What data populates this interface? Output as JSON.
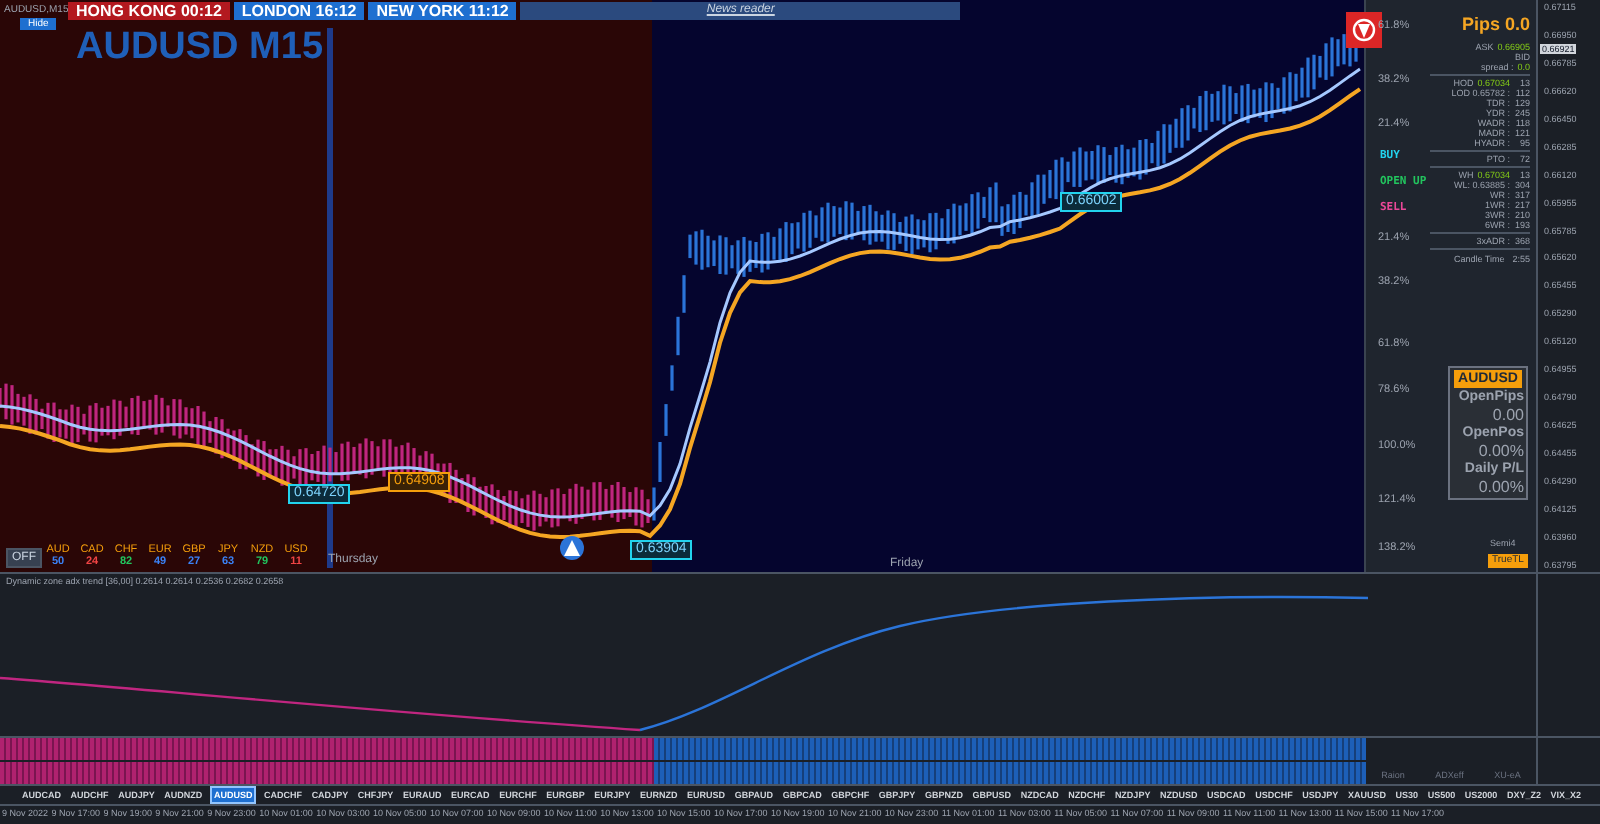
{
  "chart_header": {
    "caption": "AUDUSD,M15",
    "hide_button": "Hide"
  },
  "sessions": [
    {
      "label": "HONG KONG",
      "time": "00:12",
      "color": "#b3191f"
    },
    {
      "label": "LONDON",
      "time": "16:12",
      "color": "#1e6fd0"
    },
    {
      "label": "NEW YORK",
      "time": "11:12",
      "color": "#1e6fd0"
    }
  ],
  "news_reader": "News reader",
  "symbol_title": "AUDUSD M15",
  "fib_levels": [
    "61.8%",
    "38.2%",
    "21.4%",
    "21.4%",
    "38.2%",
    "61.8%",
    "78.6%",
    "100.0%",
    "121.4%",
    "138.2%"
  ],
  "signals": [
    {
      "label": "BUY",
      "color": "#22d3ee"
    },
    {
      "label": "OPEN UP",
      "color": "#22c55e"
    },
    {
      "label": "SELL",
      "color": "#ec4899"
    }
  ],
  "price_tags": [
    {
      "label": "0.64720",
      "kind": "cyan"
    },
    {
      "label": "0.64908",
      "kind": "orange"
    },
    {
      "label": "0.63904",
      "kind": "cyan"
    },
    {
      "label": "0.66002",
      "kind": "cyan"
    }
  ],
  "day_labels": [
    "Thursday",
    "Friday"
  ],
  "strength": {
    "toggle": "OFF",
    "currencies": [
      {
        "code": "AUD",
        "value": "50",
        "color": "#3b82f6"
      },
      {
        "code": "CAD",
        "value": "24",
        "color": "#ef4444"
      },
      {
        "code": "CHF",
        "value": "82",
        "color": "#22c55e"
      },
      {
        "code": "EUR",
        "value": "49",
        "color": "#3b82f6"
      },
      {
        "code": "GBP",
        "value": "27",
        "color": "#3b82f6"
      },
      {
        "code": "JPY",
        "value": "63",
        "color": "#3b82f6"
      },
      {
        "code": "NZD",
        "value": "79",
        "color": "#22c55e"
      },
      {
        "code": "USD",
        "value": "11",
        "color": "#ef4444"
      }
    ]
  },
  "info_panel": {
    "pips": "Pips 0.0",
    "groups": [
      [
        {
          "label": "ASK",
          "value": "0.66905"
        },
        {
          "label": "BID"
        },
        {
          "label": "spread :",
          "value": "0.0"
        }
      ],
      [
        {
          "label": "HOD",
          "value": "0.67034",
          "count": "13"
        },
        {
          "label": "LOD 0.65782 :",
          "count": "112"
        },
        {
          "label": "TDR :",
          "count": "129"
        },
        {
          "label": "YDR :",
          "count": "245"
        },
        {
          "label": "WADR :",
          "count": "118"
        },
        {
          "label": "MADR :",
          "count": "121"
        },
        {
          "label": "HYADR :",
          "count": "95"
        }
      ],
      [
        {
          "label": "PTO :",
          "count": "72"
        }
      ],
      [
        {
          "label": "WH",
          "value": "0.67034",
          "count": "13"
        },
        {
          "label": "WL: 0.63885 :",
          "count": "304"
        },
        {
          "label": "WR :",
          "count": "317"
        },
        {
          "label": "1WR :",
          "count": "217"
        },
        {
          "label": "3WR :",
          "count": "210"
        },
        {
          "label": "6WR :",
          "count": "193"
        }
      ],
      [
        {
          "label": "3xADR :",
          "count": "368"
        }
      ]
    ],
    "candle_time_label": "Candle Time",
    "candle_time": "2:55"
  },
  "account_box": {
    "symbol": "AUDUSD",
    "rows": [
      {
        "label": "OpenPips",
        "value": "0.00"
      },
      {
        "label": "OpenPos",
        "value": "0.00%"
      },
      {
        "label": "Daily P/L",
        "value": "0.00%"
      }
    ]
  },
  "semi_label": "Semi4",
  "truetl_button": "TrueTL",
  "current_price": "0.66921",
  "price_axis": [
    "0.67115",
    "0.66950",
    "0.66785",
    "0.66620",
    "0.66450",
    "0.66285",
    "0.66120",
    "0.65955",
    "0.65785",
    "0.65620",
    "0.65455",
    "0.65290",
    "0.65120",
    "0.64955",
    "0.64790",
    "0.64625",
    "0.64455",
    "0.64290",
    "0.64125",
    "0.63960",
    "0.63795"
  ],
  "indicator": {
    "label": "Dynamic zone adx trend [36,00] 0.2614 0.2614 0.2536 0.2682 0.2658"
  },
  "histogram_labels": [
    "Raion",
    "ADXeff",
    "XU-eA"
  ],
  "symbols": [
    {
      "label": "AUDCAD",
      "selected": false
    },
    {
      "label": "AUDCHF",
      "selected": false
    },
    {
      "label": "AUDJPY",
      "selected": false
    },
    {
      "label": "AUDNZD",
      "selected": false
    },
    {
      "label": "AUDUSD",
      "selected": true
    },
    {
      "label": "CADCHF",
      "selected": false
    },
    {
      "label": "CADJPY",
      "selected": false
    },
    {
      "label": "CHFJPY",
      "selected": false
    },
    {
      "label": "EURAUD",
      "selected": false
    },
    {
      "label": "EURCAD",
      "selected": false
    },
    {
      "label": "EURCHF",
      "selected": false
    },
    {
      "label": "EURGBP",
      "selected": false
    },
    {
      "label": "EURJPY",
      "selected": false
    },
    {
      "label": "EURNZD",
      "selected": false
    },
    {
      "label": "EURUSD",
      "selected": false
    },
    {
      "label": "GBPAUD",
      "selected": false
    },
    {
      "label": "GBPCAD",
      "selected": false
    },
    {
      "label": "GBPCHF",
      "selected": false
    },
    {
      "label": "GBPJPY",
      "selected": false
    },
    {
      "label": "GBPNZD",
      "selected": false
    },
    {
      "label": "GBPUSD",
      "selected": false
    },
    {
      "label": "NZDCAD",
      "selected": false
    },
    {
      "label": "NZDCHF",
      "selected": false
    },
    {
      "label": "NZDJPY",
      "selected": false
    },
    {
      "label": "NZDUSD",
      "selected": false
    },
    {
      "label": "USDCAD",
      "selected": false
    },
    {
      "label": "USDCHF",
      "selected": false
    },
    {
      "label": "USDJPY",
      "selected": false
    },
    {
      "label": "XAUUSD",
      "selected": false
    },
    {
      "label": "US30",
      "selected": false
    },
    {
      "label": "US500",
      "selected": false
    },
    {
      "label": "US2000",
      "selected": false
    },
    {
      "label": "DXY_Z2",
      "selected": false
    },
    {
      "label": "VIX_X2",
      "selected": false
    }
  ],
  "time_axis": [
    "9 Nov 2022",
    "9 Nov 17:00",
    "9 Nov 19:00",
    "9 Nov 21:00",
    "9 Nov 23:00",
    "10 Nov 01:00",
    "10 Nov 03:00",
    "10 Nov 05:00",
    "10 Nov 07:00",
    "10 Nov 09:00",
    "10 Nov 11:00",
    "10 Nov 13:00",
    "10 Nov 15:00",
    "10 Nov 17:00",
    "10 Nov 19:00",
    "10 Nov 21:00",
    "10 Nov 23:00",
    "11 Nov 01:00",
    "11 Nov 03:00",
    "11 Nov 05:00",
    "11 Nov 07:00",
    "11 Nov 09:00",
    "11 Nov 11:00",
    "11 Nov 13:00",
    "11 Nov 15:00",
    "11 Nov 17:00"
  ]
}
